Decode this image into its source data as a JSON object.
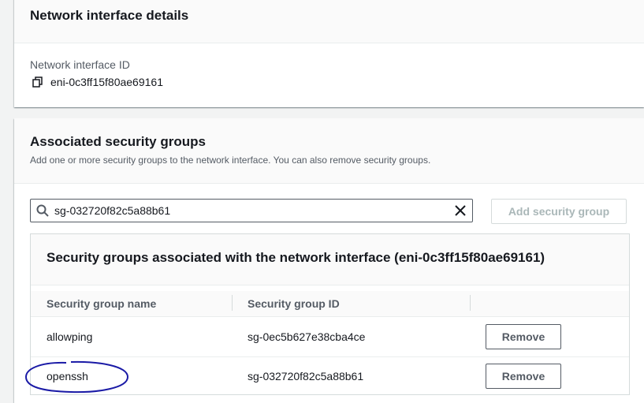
{
  "details": {
    "title": "Network interface details",
    "id_label": "Network interface ID",
    "id_value": "eni-0c3ff15f80ae69161"
  },
  "security_groups": {
    "title": "Associated security groups",
    "description": "Add one or more security groups to the network interface. You can also remove security groups.",
    "search_value": "sg-032720f82c5a88b61",
    "add_button": "Add security group",
    "table": {
      "title": "Security groups associated with the network interface (eni-0c3ff15f80ae69161)",
      "columns": [
        "Security group name",
        "Security group ID"
      ],
      "rows": [
        {
          "name": "allowping",
          "id": "sg-0ec5b627e38cba4ce",
          "action": "Remove"
        },
        {
          "name": "openssh",
          "id": "sg-032720f82c5a88b61",
          "action": "Remove"
        }
      ]
    }
  },
  "colors": {
    "annotation": "#1a1aa6",
    "border_dark": "#545b64",
    "disabled_text": "#aab7b8"
  },
  "icons": [
    "copy-icon",
    "search-icon",
    "close-icon"
  ]
}
